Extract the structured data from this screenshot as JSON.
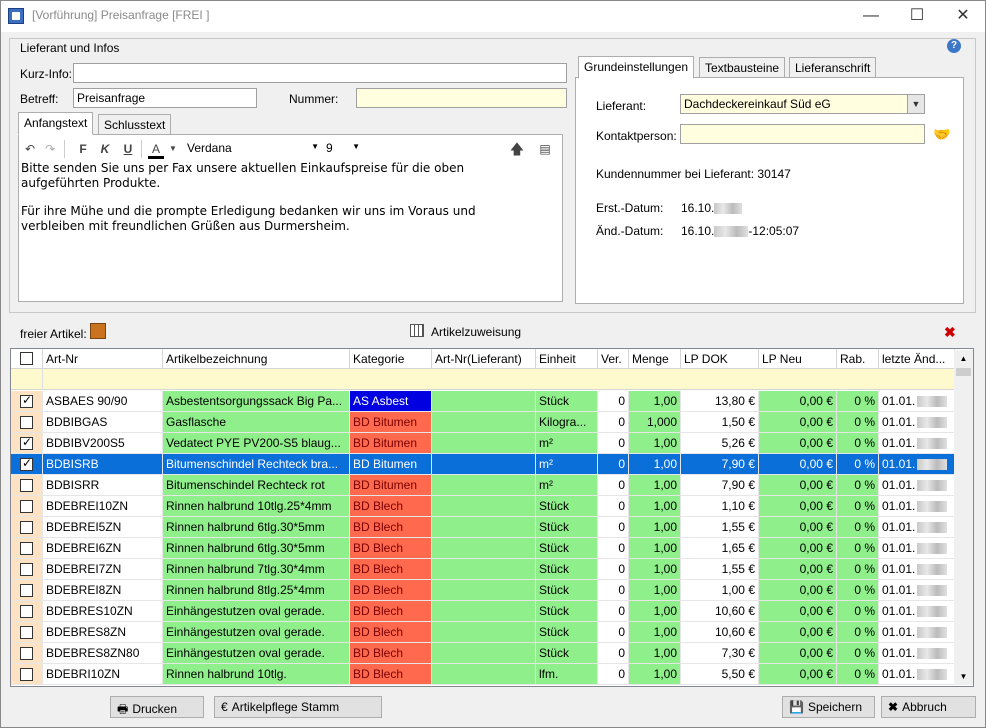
{
  "window": {
    "title": "[Vorführung] Preisanfrage  [FREI ]"
  },
  "group": {
    "title": "Lieferant und Infos"
  },
  "fields": {
    "kurzinfo_label": "Kurz-Info:",
    "kurzinfo_value": "",
    "betreff_label": "Betreff:",
    "betreff_value": "Preisanfrage",
    "nummer_label": "Nummer:",
    "nummer_value": ""
  },
  "text_tabs": [
    "Anfangstext",
    "Schlusstext"
  ],
  "editor": {
    "font": "Verdana",
    "size": "9",
    "bold_label": "F",
    "italic_label": "K",
    "underline_label": "U",
    "color_label": "A",
    "paragraph1": "Bitte senden Sie uns per Fax unsere aktuellen Einkaufspreise für die oben aufgeführten Produkte.",
    "paragraph2": "Für ihre Mühe und die prompte Erledigung bedanken wir uns im Voraus und verbleiben mit freundlichen Grüßen aus Durmersheim."
  },
  "right_tabs": [
    "Grundeinstellungen",
    "Textbausteine",
    "Lieferanschrift"
  ],
  "right": {
    "lieferant_label": "Lieferant:",
    "lieferant_value": "Dachdeckereinkauf Süd eG",
    "kontakt_label": "Kontaktperson:",
    "kontakt_value": "",
    "kundennummer": "Kundennummer bei Lieferant: 30147",
    "erst_label": "Erst.-Datum:",
    "erst_value": "16.10.",
    "aend_label": "Änd.-Datum:",
    "aend_value": "16.10.",
    "aend_time": "-12:05:07"
  },
  "grid_toolbar": {
    "freier_artikel": "freier Artikel:",
    "artikelzuweisung": "Artikelzuweisung"
  },
  "columns": [
    "Art-Nr",
    "Artikelbezeichnung",
    "Kategorie",
    "Art-Nr(Lieferant)",
    "Einheit",
    "Ver.",
    "Menge",
    "LP DOK",
    "LP Neu",
    "Rab.",
    "letzte Änd..."
  ],
  "rows": [
    {
      "checked": true,
      "artnr": "ASBAES 90/90",
      "bez": "Asbestentsorgungssack Big Pa...",
      "kat": "AS Asbest",
      "katcolor": "blue",
      "lief": "",
      "einheit": "Stück",
      "ver": "0",
      "menge": "1,00",
      "lpdok": "13,80 €",
      "lpneu": "0,00 €",
      "rab": "0 %",
      "aend": "01.01."
    },
    {
      "checked": false,
      "artnr": "BDBIBGAS",
      "bez": "Gasflasche",
      "kat": "BD Bitumen",
      "katcolor": "red",
      "lief": "",
      "einheit": "Kilogra...",
      "ver": "0",
      "menge": "1,000",
      "lpdok": "1,50 €",
      "lpneu": "0,00 €",
      "rab": "0 %",
      "aend": "01.01."
    },
    {
      "checked": true,
      "artnr": "BDBIBV200S5",
      "bez": "Vedatect PYE PV200-S5 blaug...",
      "kat": "BD Bitumen",
      "katcolor": "red",
      "lief": "",
      "einheit": "m²",
      "ver": "0",
      "menge": "1,00",
      "lpdok": "5,26 €",
      "lpneu": "0,00 €",
      "rab": "0 %",
      "aend": "01.01."
    },
    {
      "checked": true,
      "selected": true,
      "artnr": "BDBISRB",
      "bez": "Bitumenschindel Rechteck bra...",
      "kat": "BD Bitumen",
      "katcolor": "red",
      "lief": "",
      "einheit": "m²",
      "ver": "0",
      "menge": "1,00",
      "lpdok": "7,90 €",
      "lpneu": "0,00 €",
      "rab": "0 %",
      "aend": "01.01."
    },
    {
      "checked": false,
      "artnr": "BDBISRR",
      "bez": "Bitumenschindel Rechteck rot",
      "kat": "BD Bitumen",
      "katcolor": "red",
      "lief": "",
      "einheit": "m²",
      "ver": "0",
      "menge": "1,00",
      "lpdok": "7,90 €",
      "lpneu": "0,00 €",
      "rab": "0 %",
      "aend": "01.01."
    },
    {
      "checked": false,
      "artnr": "BDEBREI10ZN",
      "bez": "Rinnen halbrund 10tlg.25*4mm",
      "kat": "BD Blech",
      "katcolor": "red",
      "lief": "",
      "einheit": "Stück",
      "ver": "0",
      "menge": "1,00",
      "lpdok": "1,10 €",
      "lpneu": "0,00 €",
      "rab": "0 %",
      "aend": "01.01."
    },
    {
      "checked": false,
      "artnr": "BDEBREI5ZN",
      "bez": "Rinnen halbrund 6tlg.30*5mm",
      "kat": "BD Blech",
      "katcolor": "red",
      "lief": "",
      "einheit": "Stück",
      "ver": "0",
      "menge": "1,00",
      "lpdok": "1,55 €",
      "lpneu": "0,00 €",
      "rab": "0 %",
      "aend": "01.01."
    },
    {
      "checked": false,
      "artnr": "BDEBREI6ZN",
      "bez": "Rinnen halbrund 6tlg.30*5mm",
      "kat": "BD Blech",
      "katcolor": "red",
      "lief": "",
      "einheit": "Stück",
      "ver": "0",
      "menge": "1,00",
      "lpdok": "1,65 €",
      "lpneu": "0,00 €",
      "rab": "0 %",
      "aend": "01.01."
    },
    {
      "checked": false,
      "artnr": "BDEBREI7ZN",
      "bez": "Rinnen halbrund 7tlg.30*4mm",
      "kat": "BD Blech",
      "katcolor": "red",
      "lief": "",
      "einheit": "Stück",
      "ver": "0",
      "menge": "1,00",
      "lpdok": "1,55 €",
      "lpneu": "0,00 €",
      "rab": "0 %",
      "aend": "01.01."
    },
    {
      "checked": false,
      "artnr": "BDEBREI8ZN",
      "bez": "Rinnen halbrund 8tlg.25*4mm",
      "kat": "BD Blech",
      "katcolor": "red",
      "lief": "",
      "einheit": "Stück",
      "ver": "0",
      "menge": "1,00",
      "lpdok": "1,00 €",
      "lpneu": "0,00 €",
      "rab": "0 %",
      "aend": "01.01."
    },
    {
      "checked": false,
      "artnr": "BDEBRES10ZN",
      "bez": "Einhängestutzen oval gerade.",
      "kat": "BD Blech",
      "katcolor": "red",
      "lief": "",
      "einheit": "Stück",
      "ver": "0",
      "menge": "1,00",
      "lpdok": "10,60 €",
      "lpneu": "0,00 €",
      "rab": "0 %",
      "aend": "01.01."
    },
    {
      "checked": false,
      "artnr": "BDEBRES8ZN",
      "bez": "Einhängestutzen oval gerade.",
      "kat": "BD Blech",
      "katcolor": "red",
      "lief": "",
      "einheit": "Stück",
      "ver": "0",
      "menge": "1,00",
      "lpdok": "10,60 €",
      "lpneu": "0,00 €",
      "rab": "0 %",
      "aend": "01.01."
    },
    {
      "checked": false,
      "artnr": "BDEBRES8ZN80",
      "bez": "Einhängestutzen oval gerade.",
      "kat": "BD Blech",
      "katcolor": "red",
      "lief": "",
      "einheit": "Stück",
      "ver": "0",
      "menge": "1,00",
      "lpdok": "7,30 €",
      "lpneu": "0,00 €",
      "rab": "0 %",
      "aend": "01.01."
    },
    {
      "checked": false,
      "artnr": "BDEBRI10ZN",
      "bez": "Rinnen halbrund 10tlg.",
      "kat": "BD Blech",
      "katcolor": "red",
      "lief": "",
      "einheit": "lfm.",
      "ver": "0",
      "menge": "1,00",
      "lpdok": "5,50 €",
      "lpneu": "0,00 €",
      "rab": "0 %",
      "aend": "01.01."
    }
  ],
  "buttons": {
    "drucken": "Drucken",
    "artikelpflege": "Artikelpflege Stamm",
    "speichern": "Speichern",
    "abbruch": "Abbruch"
  }
}
